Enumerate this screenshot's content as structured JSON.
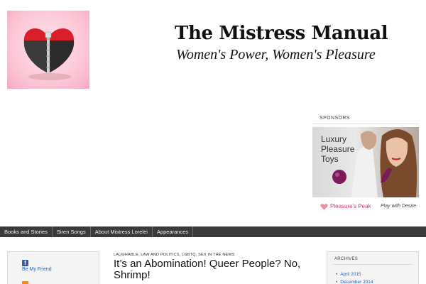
{
  "header": {
    "title": "The Mistress Manual",
    "tagline": "Women's Power, Women's Pleasure"
  },
  "sponsors": {
    "heading": "SPONSORS",
    "ad_text": "Luxury Pleasure Toys",
    "brand": "Pleasure's Peak",
    "cta": "Play with Desire"
  },
  "nav": {
    "items": [
      {
        "label": "Books and Stories"
      },
      {
        "label": "Siren Songs"
      },
      {
        "label": "About Mistress Lorelei"
      },
      {
        "label": "Appearances"
      }
    ]
  },
  "left_sidebar": {
    "facebook_label": "Be My Friend"
  },
  "post": {
    "categories": "LAUGHABLE, LAW AND POLITICS, LGBTQ, SEX IN THE NEWS",
    "title": "It’s an Abomination! Queer People? No, Shrimp!"
  },
  "archives": {
    "heading": "ARCHIVES",
    "items": [
      {
        "label": "April 2015"
      },
      {
        "label": "December 2014"
      }
    ]
  },
  "colors": {
    "nav_bg": "#3a3a3a",
    "link": "#2a62b8",
    "brand_pink": "#d23d6d",
    "logo_pink": "#fbc2d3"
  }
}
